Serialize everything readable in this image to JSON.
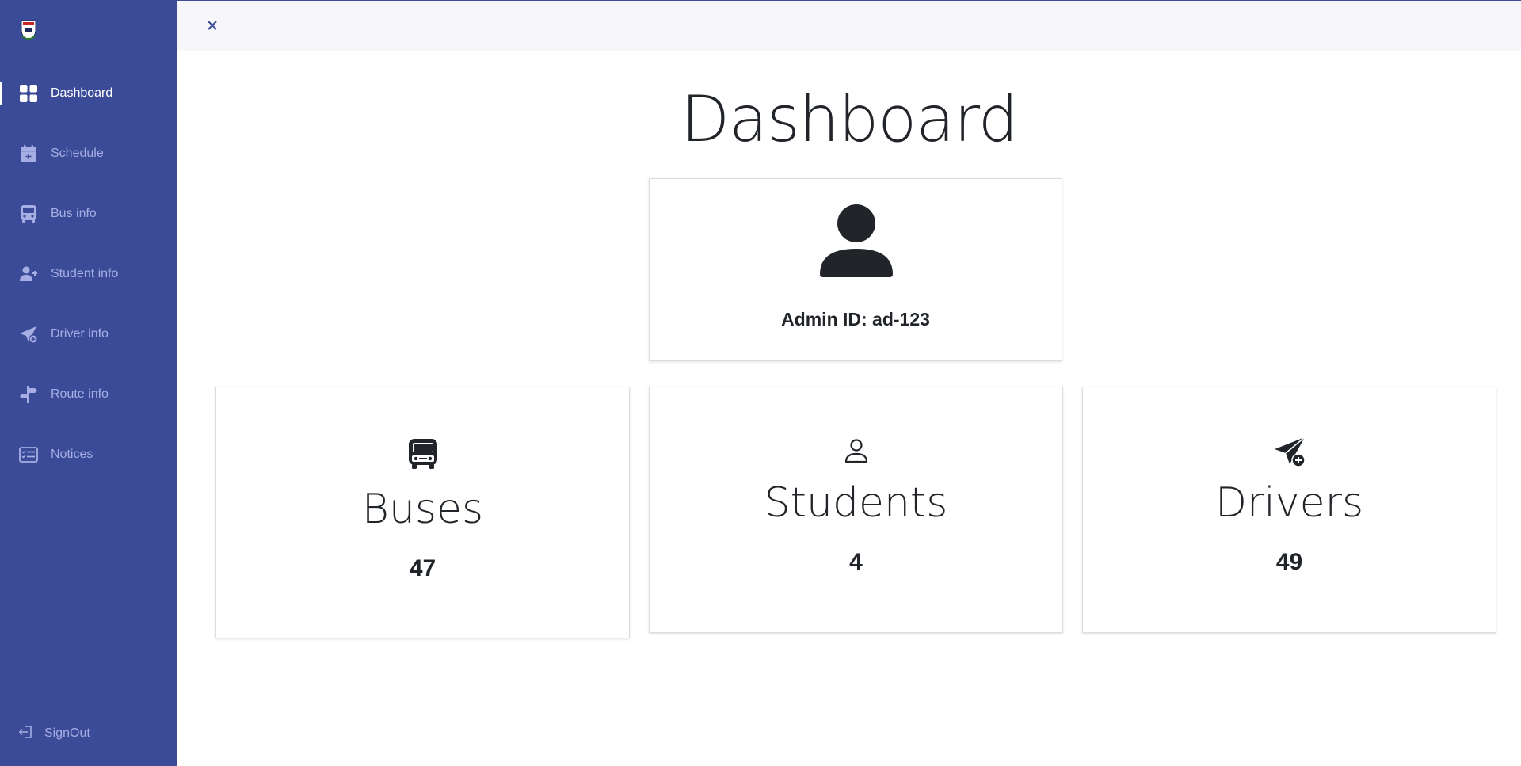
{
  "sidebar": {
    "logo_icon": "university-crest-icon",
    "items": [
      {
        "label": "Dashboard",
        "icon": "grid-icon",
        "active": true
      },
      {
        "label": "Schedule",
        "icon": "calendar-plus-icon"
      },
      {
        "label": "Bus info",
        "icon": "bus-icon"
      },
      {
        "label": "Student info",
        "icon": "person-add-icon"
      },
      {
        "label": "Driver info",
        "icon": "send-plus-icon"
      },
      {
        "label": "Route info",
        "icon": "signpost-icon"
      },
      {
        "label": "Notices",
        "icon": "checklist-icon"
      }
    ],
    "signout_label": "SignOut"
  },
  "topbar": {
    "close_icon": "close-icon"
  },
  "main": {
    "title": "Dashboard",
    "admin": {
      "label": "Admin ID: ad-123"
    },
    "stats": [
      {
        "title": "Buses",
        "count": "47",
        "icon": "bus-icon"
      },
      {
        "title": "Students",
        "count": "4",
        "icon": "person-icon"
      },
      {
        "title": "Drivers",
        "count": "49",
        "icon": "send-plus-icon"
      }
    ]
  },
  "colors": {
    "sidebar_bg": "#3b4b98",
    "nav_text": "#a6aee3",
    "active_text": "#ffffff",
    "topbar_bg": "#f7f7fb"
  }
}
